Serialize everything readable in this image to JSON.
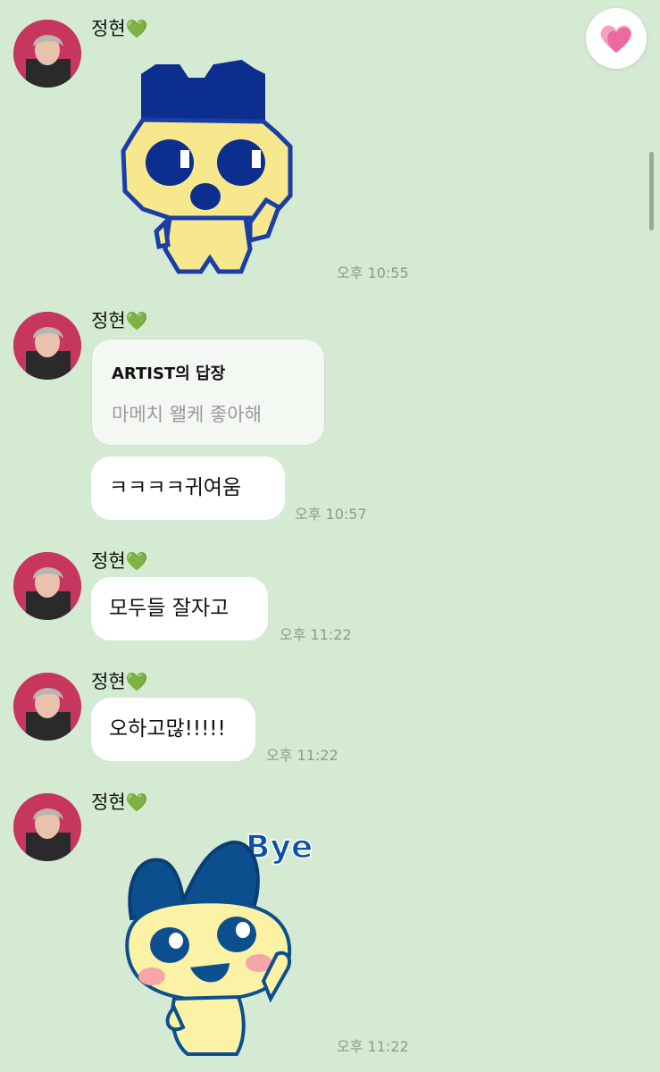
{
  "sender_name": "정현",
  "heart_emoji": "💚",
  "messages": [
    {
      "type": "sticker",
      "sticker": "pixel-mametchi",
      "time": "오후 10:55"
    },
    {
      "type": "reply",
      "reply_title": "ARTIST의 답장",
      "reply_text": "마메치 왤케 좋아해",
      "text": "ㅋㅋㅋㅋ귀여움",
      "time": "오후 10:57"
    },
    {
      "type": "text",
      "text": "모두들 잘자고",
      "time": "오후 11:22"
    },
    {
      "type": "text",
      "text": "오하고많!!!!!",
      "time": "오후 11:22"
    },
    {
      "type": "sticker",
      "sticker": "mametchi-bye",
      "sticker_text": "Bye",
      "time": "오후 11:22"
    }
  ],
  "icons": {
    "favorite": "heart-icon",
    "scroll": "scrollbar"
  },
  "colors": {
    "background": "#d4ead2",
    "bubble": "#ffffff",
    "heart_pink": "#ea6aa0",
    "time": "#8c9a8a"
  }
}
